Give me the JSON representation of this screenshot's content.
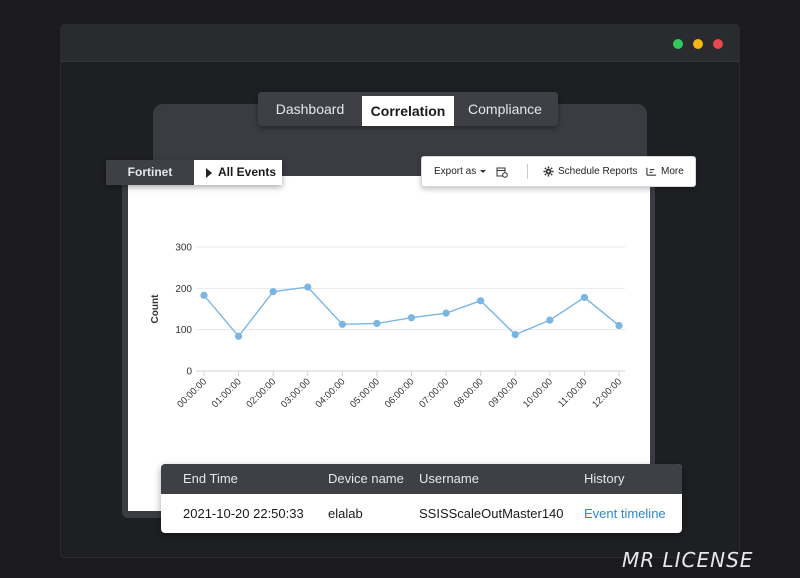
{
  "window": {
    "controls": [
      {
        "name": "green",
        "color": "#34c759"
      },
      {
        "name": "yellow",
        "color": "#f5b616"
      },
      {
        "name": "red",
        "color": "#e5484d"
      }
    ]
  },
  "tabs": [
    {
      "label": "Dashboard",
      "active": false
    },
    {
      "label": "Correlation",
      "active": true
    },
    {
      "label": "Compliance",
      "active": false
    }
  ],
  "breadcrumb": {
    "parent": "Fortinet",
    "current": "All Events"
  },
  "toolbar": {
    "export_label": "Export as",
    "calendar_icon": "calendar-icon",
    "schedule_label": "Schedule Reports",
    "schedule_icon": "gear-icon",
    "more_label": "More",
    "more_icon": "list-icon"
  },
  "chart_data": {
    "type": "line",
    "ylabel": "Count",
    "xlabel": "",
    "ylim": [
      0,
      300
    ],
    "yticks": [
      0,
      100,
      200,
      300
    ],
    "grid": true,
    "color": "#7bb6e3",
    "categories": [
      "00:00:00",
      "01:00:00",
      "02:00:00",
      "03:00:00",
      "04:00:00",
      "05:00:00",
      "06:00:00",
      "07:00:00",
      "08:00:00",
      "09:00:00",
      "10:00:00",
      "11:00:00",
      "12:00:00"
    ],
    "values": [
      183,
      84,
      192,
      203,
      113,
      115,
      129,
      140,
      170,
      88,
      123,
      178,
      110
    ]
  },
  "table": {
    "headers": [
      "End Time",
      "Device name",
      "Username",
      "History"
    ],
    "rows": [
      [
        "2021-10-20 22:50:33",
        "elalab",
        "SSISScaleOutMaster140",
        "Event timeline"
      ]
    ]
  },
  "watermark": "MR LICENSE"
}
